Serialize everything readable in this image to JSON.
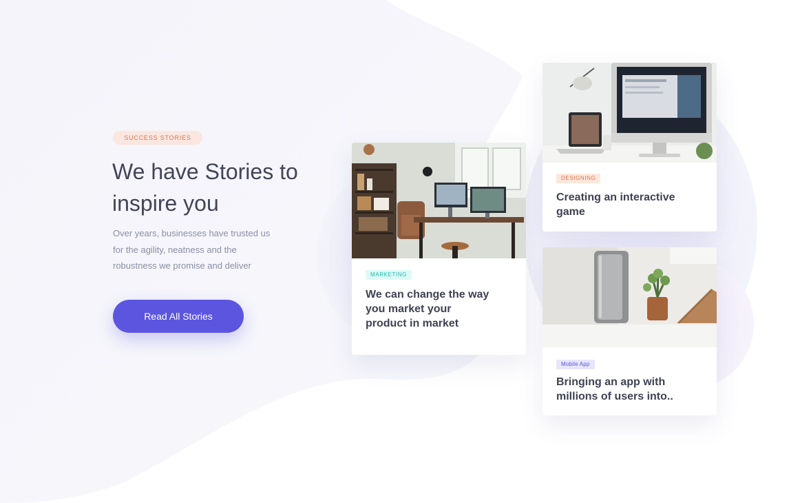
{
  "hero": {
    "badge": "SUCCESS STORIES",
    "headline": "We have Stories to inspire you",
    "description": "Over years, businesses have trusted us for the agility, neatness and the robustness we promise and deliver",
    "cta_label": "Read All Stories"
  },
  "stories": [
    {
      "tag": "MARKETING",
      "title": "We can change the way you market your product in market",
      "image": "home-office-desk-photo"
    },
    {
      "tag": "DESIGNING",
      "title": "Creating an interactive game",
      "image": "imac-workstation-photo"
    },
    {
      "tag": "Mobile App",
      "title": "Bringing an app with millions of users into..",
      "image": "speaker-and-plant-photo"
    }
  ],
  "colors": {
    "accent": "#5b55e0",
    "badge_bg": "#fbe6e0",
    "badge_text": "#d57a55",
    "marketing_tag_text": "#22b8ae",
    "designing_tag_text": "#dd7650",
    "mobile_tag_text": "#5b55e0",
    "heading": "#424558",
    "body_text": "#8b8fa3"
  }
}
